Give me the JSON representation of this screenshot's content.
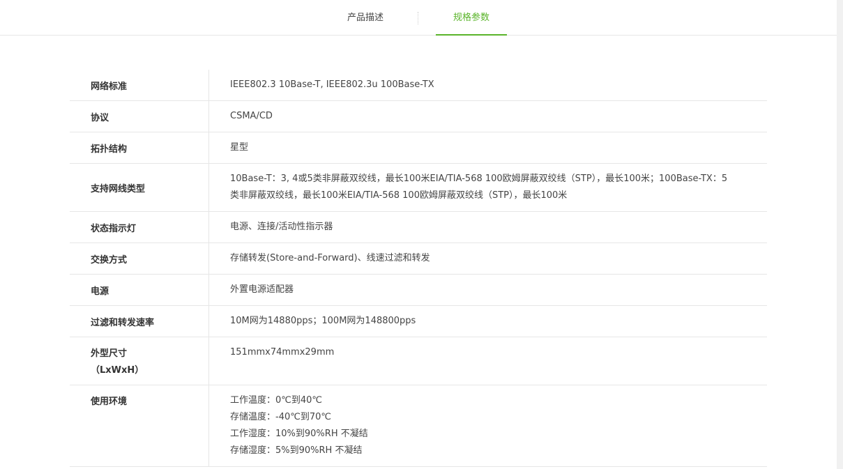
{
  "tabs": {
    "description": "产品描述",
    "specs": "规格参数",
    "active": "规格参数"
  },
  "colors": {
    "accent": "#5ab42a",
    "border": "#e6e6e6"
  },
  "specs": [
    {
      "label": "网络标准",
      "value": "IEEE802.3 10Base-T, IEEE802.3u 100Base-TX"
    },
    {
      "label": "协议",
      "value": "CSMA/CD"
    },
    {
      "label": "拓扑结构",
      "value": "星型"
    },
    {
      "label": "支持网线类型",
      "value": "10Base-T：3, 4或5类非屏蔽双绞线，最长100米EIA/TIA-568 100欧姆屏蔽双绞线（STP），最长100米；100Base-TX：5类非屏蔽双绞线，最长100米EIA/TIA-568 100欧姆屏蔽双绞线（STP），最长100米"
    },
    {
      "label": "状态指示灯",
      "value": "电源、连接/活动性指示器"
    },
    {
      "label": "交换方式",
      "value": "存储转发(Store-and-Forward)、线速过滤和转发"
    },
    {
      "label": "电源",
      "value": "外置电源适配器"
    },
    {
      "label": "过滤和转发速率",
      "value": "10M网为14880pps；100M网为148800pps"
    },
    {
      "label": "外型尺寸\n（LxWxH）",
      "value": "151mmx74mmx29mm"
    },
    {
      "label": "使用环境",
      "lines": [
        "工作温度：0℃到40℃",
        "存储温度：-40℃到70℃",
        "工作湿度：10%到90%RH 不凝结",
        "存储湿度：5%到90%RH 不凝结"
      ]
    }
  ]
}
